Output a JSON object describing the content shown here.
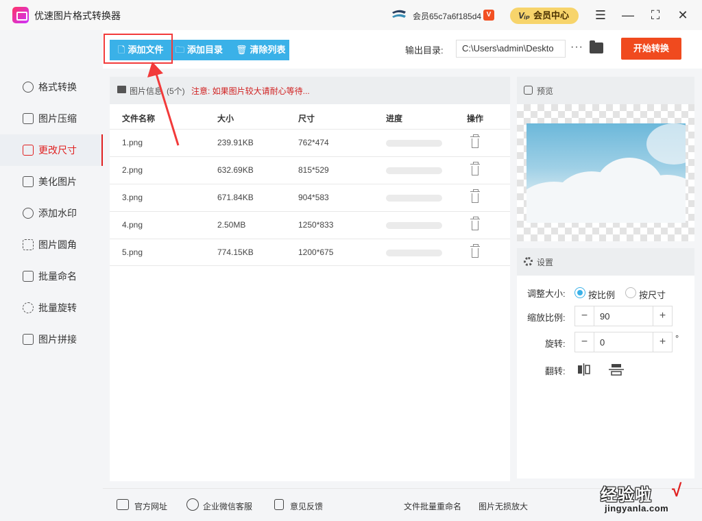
{
  "app": {
    "title": "优速图片格式转换器"
  },
  "titlebar": {
    "member_id": "会员65c7a6f185d4",
    "vip_badge": "V",
    "vip_center": "会员中心",
    "vip_center_mark": "Vᵢₚ",
    "menu_glyph": "☰",
    "minimize_glyph": "—",
    "maximize_glyph": "⛶",
    "close_glyph": "✕"
  },
  "toolbar": {
    "add_file": "添加文件",
    "add_folder": "添加目录",
    "clear_list": "清除列表",
    "output_label": "输出目录:",
    "output_path": "C:\\Users\\admin\\Deskto",
    "more": "···",
    "start": "开始转换"
  },
  "sidebar": {
    "items": [
      {
        "label": "格式转换",
        "icon": "format-convert-icon"
      },
      {
        "label": "图片压缩",
        "icon": "compress-icon"
      },
      {
        "label": "更改尺寸",
        "icon": "resize-icon",
        "active": true
      },
      {
        "label": "美化图片",
        "icon": "beautify-icon"
      },
      {
        "label": "添加水印",
        "icon": "watermark-icon"
      },
      {
        "label": "图片圆角",
        "icon": "round-corner-icon"
      },
      {
        "label": "批量命名",
        "icon": "rename-icon"
      },
      {
        "label": "批量旋转",
        "icon": "rotate-icon"
      },
      {
        "label": "图片拼接",
        "icon": "stitch-icon"
      }
    ]
  },
  "file_list": {
    "title": "图片信息",
    "count": "(5个)",
    "note": "注意: 如果图片较大请耐心等待...",
    "columns": {
      "name": "文件名称",
      "size": "大小",
      "dimensions": "尺寸",
      "progress": "进度",
      "action": "操作"
    },
    "rows": [
      {
        "name": "1.png",
        "size": "239.91KB",
        "dimensions": "762*474",
        "progress": 0
      },
      {
        "name": "2.png",
        "size": "632.69KB",
        "dimensions": "815*529",
        "progress": 0
      },
      {
        "name": "3.png",
        "size": "671.84KB",
        "dimensions": "904*583",
        "progress": 0
      },
      {
        "name": "4.png",
        "size": "2.50MB",
        "dimensions": "1250*833",
        "progress": 0
      },
      {
        "name": "5.png",
        "size": "774.15KB",
        "dimensions": "1200*675",
        "progress": 0
      }
    ]
  },
  "preview": {
    "title": "预览"
  },
  "settings": {
    "title": "设置",
    "resize_label": "调整大小:",
    "by_ratio": "按比例",
    "by_size": "按尺寸",
    "scale_label": "缩放比例:",
    "scale_value": "90",
    "rotate_label": "旋转:",
    "rotate_value": "0",
    "degree": "°",
    "flip_label": "翻转:",
    "minus": "−",
    "plus": "+"
  },
  "footer": {
    "website": "官方网址",
    "wechat_service": "企业微信客服",
    "feedback": "意见反馈",
    "batch_rename": "文件批量重命名",
    "lossless_enlarge": "图片无损放大"
  },
  "watermark": {
    "cn": "经验啦",
    "check": "√",
    "en": "jingyanla.com"
  },
  "colors": {
    "accent_blue": "#3ab1e8",
    "start_orange": "#f04a1e",
    "active_red": "#e02020",
    "vip_gold": "#f7d46b"
  }
}
